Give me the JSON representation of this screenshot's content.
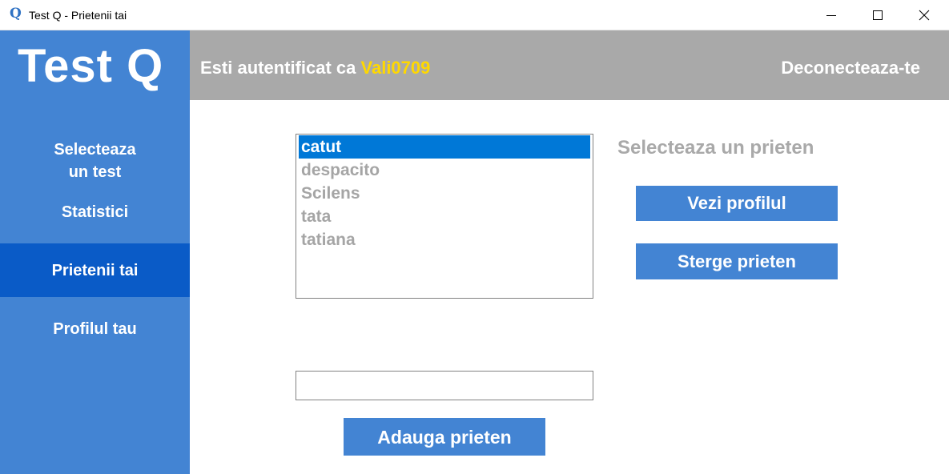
{
  "window": {
    "app_icon_glyph": "Q",
    "title": "Test Q - Prietenii tai",
    "controls": [
      "minimize-icon",
      "maximize-icon",
      "close-icon"
    ]
  },
  "sidebar": {
    "logo": "Test Q",
    "items": [
      {
        "line1": "Selecteaza",
        "line2": "un test"
      },
      {
        "label": "Statistici"
      },
      {
        "label": "Prietenii tai",
        "active": true
      },
      {
        "label": "Profilul tau"
      }
    ]
  },
  "header": {
    "auth_prefix": "Esti autentificat ca",
    "username": "Vali0709",
    "logout": "Deconecteaza-te"
  },
  "friends": {
    "list": [
      "catut",
      "despacito",
      "Scilens",
      "tata",
      "tatiana"
    ],
    "selected": "catut",
    "select_label": "Selecteaza un prieten",
    "view_profile_button": "Vezi profilul",
    "delete_button": "Sterge prieten",
    "add_input_value": "",
    "add_button": "Adauga prieten"
  },
  "colors": {
    "sidebar": "#4384d3",
    "sidebar_active": "#0a5bc7",
    "header": "#a9a9a9",
    "username": "#ffd800",
    "selection": "#0078d7"
  }
}
